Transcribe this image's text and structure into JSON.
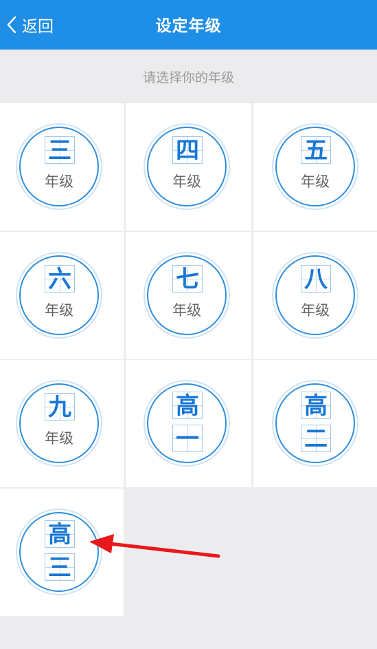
{
  "header": {
    "back_label": "返回",
    "title": "设定年级",
    "color": "#1e8ee6"
  },
  "hint": "请选择你的年级",
  "grades": [
    {
      "char": "三",
      "sub": "年级"
    },
    {
      "char": "四",
      "sub": "年级"
    },
    {
      "char": "五",
      "sub": "年级"
    },
    {
      "char": "六",
      "sub": "年级"
    },
    {
      "char": "七",
      "sub": "年级"
    },
    {
      "char": "八",
      "sub": "年级"
    },
    {
      "char": "九",
      "sub": "年级"
    },
    {
      "char": "高",
      "char2": "一"
    },
    {
      "char": "高",
      "char2": "二"
    },
    {
      "char": "高",
      "char2": "三"
    }
  ],
  "accent_color": "#1877d6",
  "annotation": {
    "arrow_color": "#e8181c",
    "points_to": "高三"
  }
}
